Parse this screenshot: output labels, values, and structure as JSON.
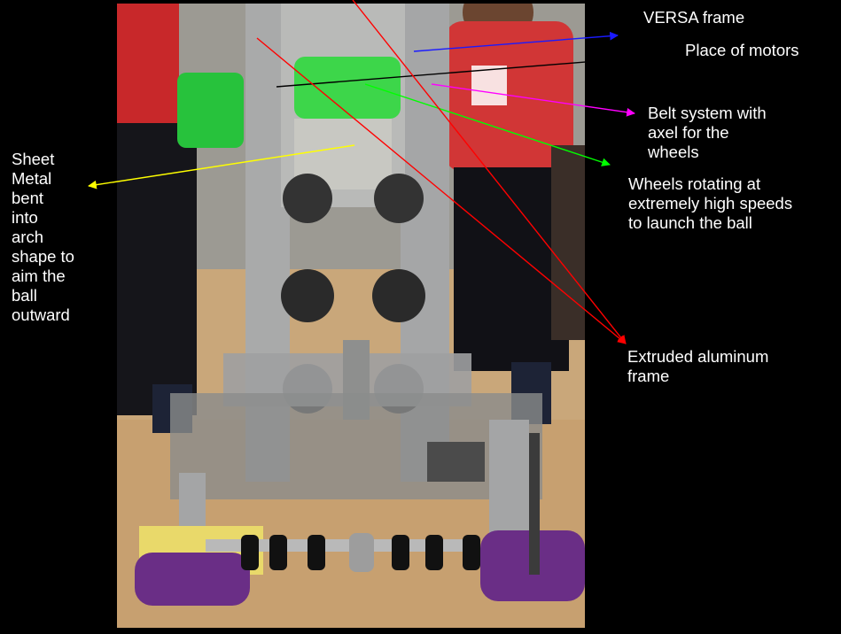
{
  "annotations": [
    {
      "id": "versa",
      "text": "VERSA frame",
      "arrow_color": "#1a1aff"
    },
    {
      "id": "motors",
      "text": "Place of motors",
      "arrow_color": "#000000"
    },
    {
      "id": "belt",
      "text": "Belt system with\naxel for the\nwheels",
      "arrow_color": "#ff00ff"
    },
    {
      "id": "wheels",
      "text": "Wheels rotating at\nextremely high speeds\nto launch the ball",
      "arrow_color": "#00ff00"
    },
    {
      "id": "aluminum",
      "text": "Extruded aluminum\nframe",
      "arrow_color": "#ff0000"
    },
    {
      "id": "sheet",
      "text": "Sheet\nMetal\nbent\ninto\narch\nshape to\naim the\nball\noutward",
      "arrow_color": "#ffff00"
    }
  ]
}
